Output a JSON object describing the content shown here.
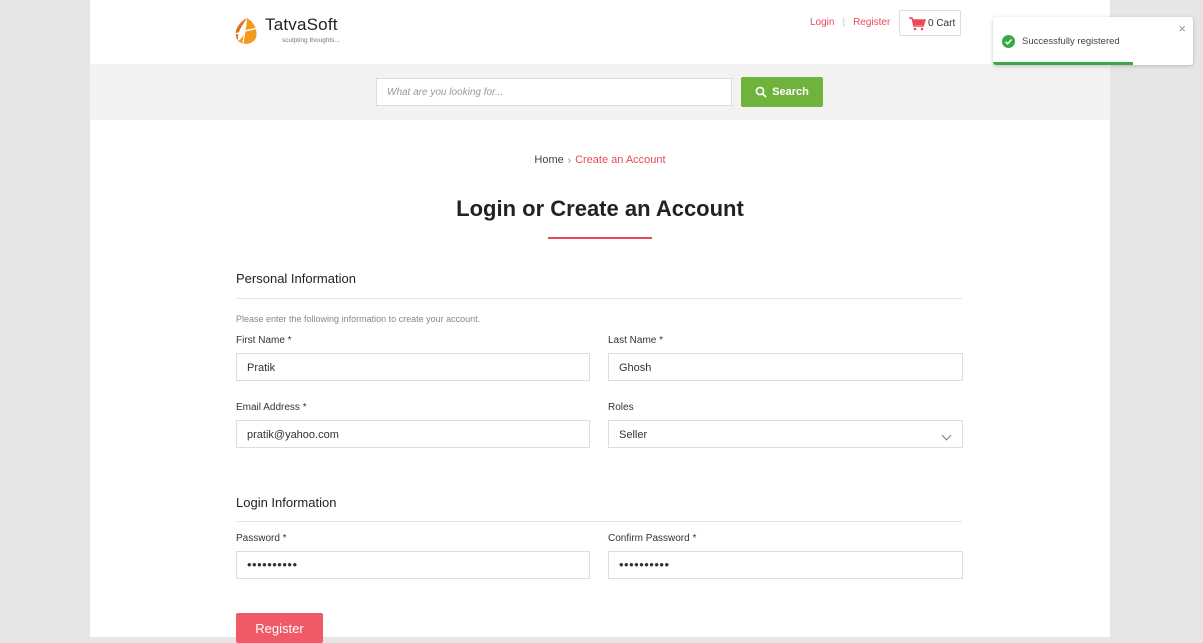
{
  "header": {
    "logo_name": "TatvaSoft",
    "logo_tagline": "sculpting thoughts...",
    "login_link": "Login",
    "register_link": "Register",
    "cart_label": "0 Cart"
  },
  "search": {
    "placeholder": "What are you looking for...",
    "value": "",
    "button_label": "Search"
  },
  "breadcrumb": {
    "home": "Home",
    "current": "Create an Account"
  },
  "page_title": "Login or Create an Account",
  "personal": {
    "heading": "Personal Information",
    "note": "Please enter the following information to create your account.",
    "first_name_label": "First Name *",
    "first_name_value": "Pratik",
    "last_name_label": "Last Name *",
    "last_name_value": "Ghosh",
    "email_label": "Email Address *",
    "email_value": "pratik@yahoo.com",
    "roles_label": "Roles",
    "roles_value": "Seller"
  },
  "login": {
    "heading": "Login Information",
    "password_label": "Password *",
    "password_mask": "••••••••••",
    "confirm_label": "Confirm Password *",
    "confirm_mask": "••••••••••"
  },
  "register_button": "Register",
  "toast": {
    "message": "Successfully registered",
    "close": "×",
    "progress": 0.7,
    "color": "#39a845"
  },
  "colors": {
    "accent": "#e84a5a",
    "search_button": "#6fb33c",
    "register_button": "#f05a67"
  },
  "icons": [
    "logo-icon",
    "cart-icon",
    "search-icon",
    "chevron-down-icon",
    "check-circle-icon",
    "close-icon"
  ]
}
